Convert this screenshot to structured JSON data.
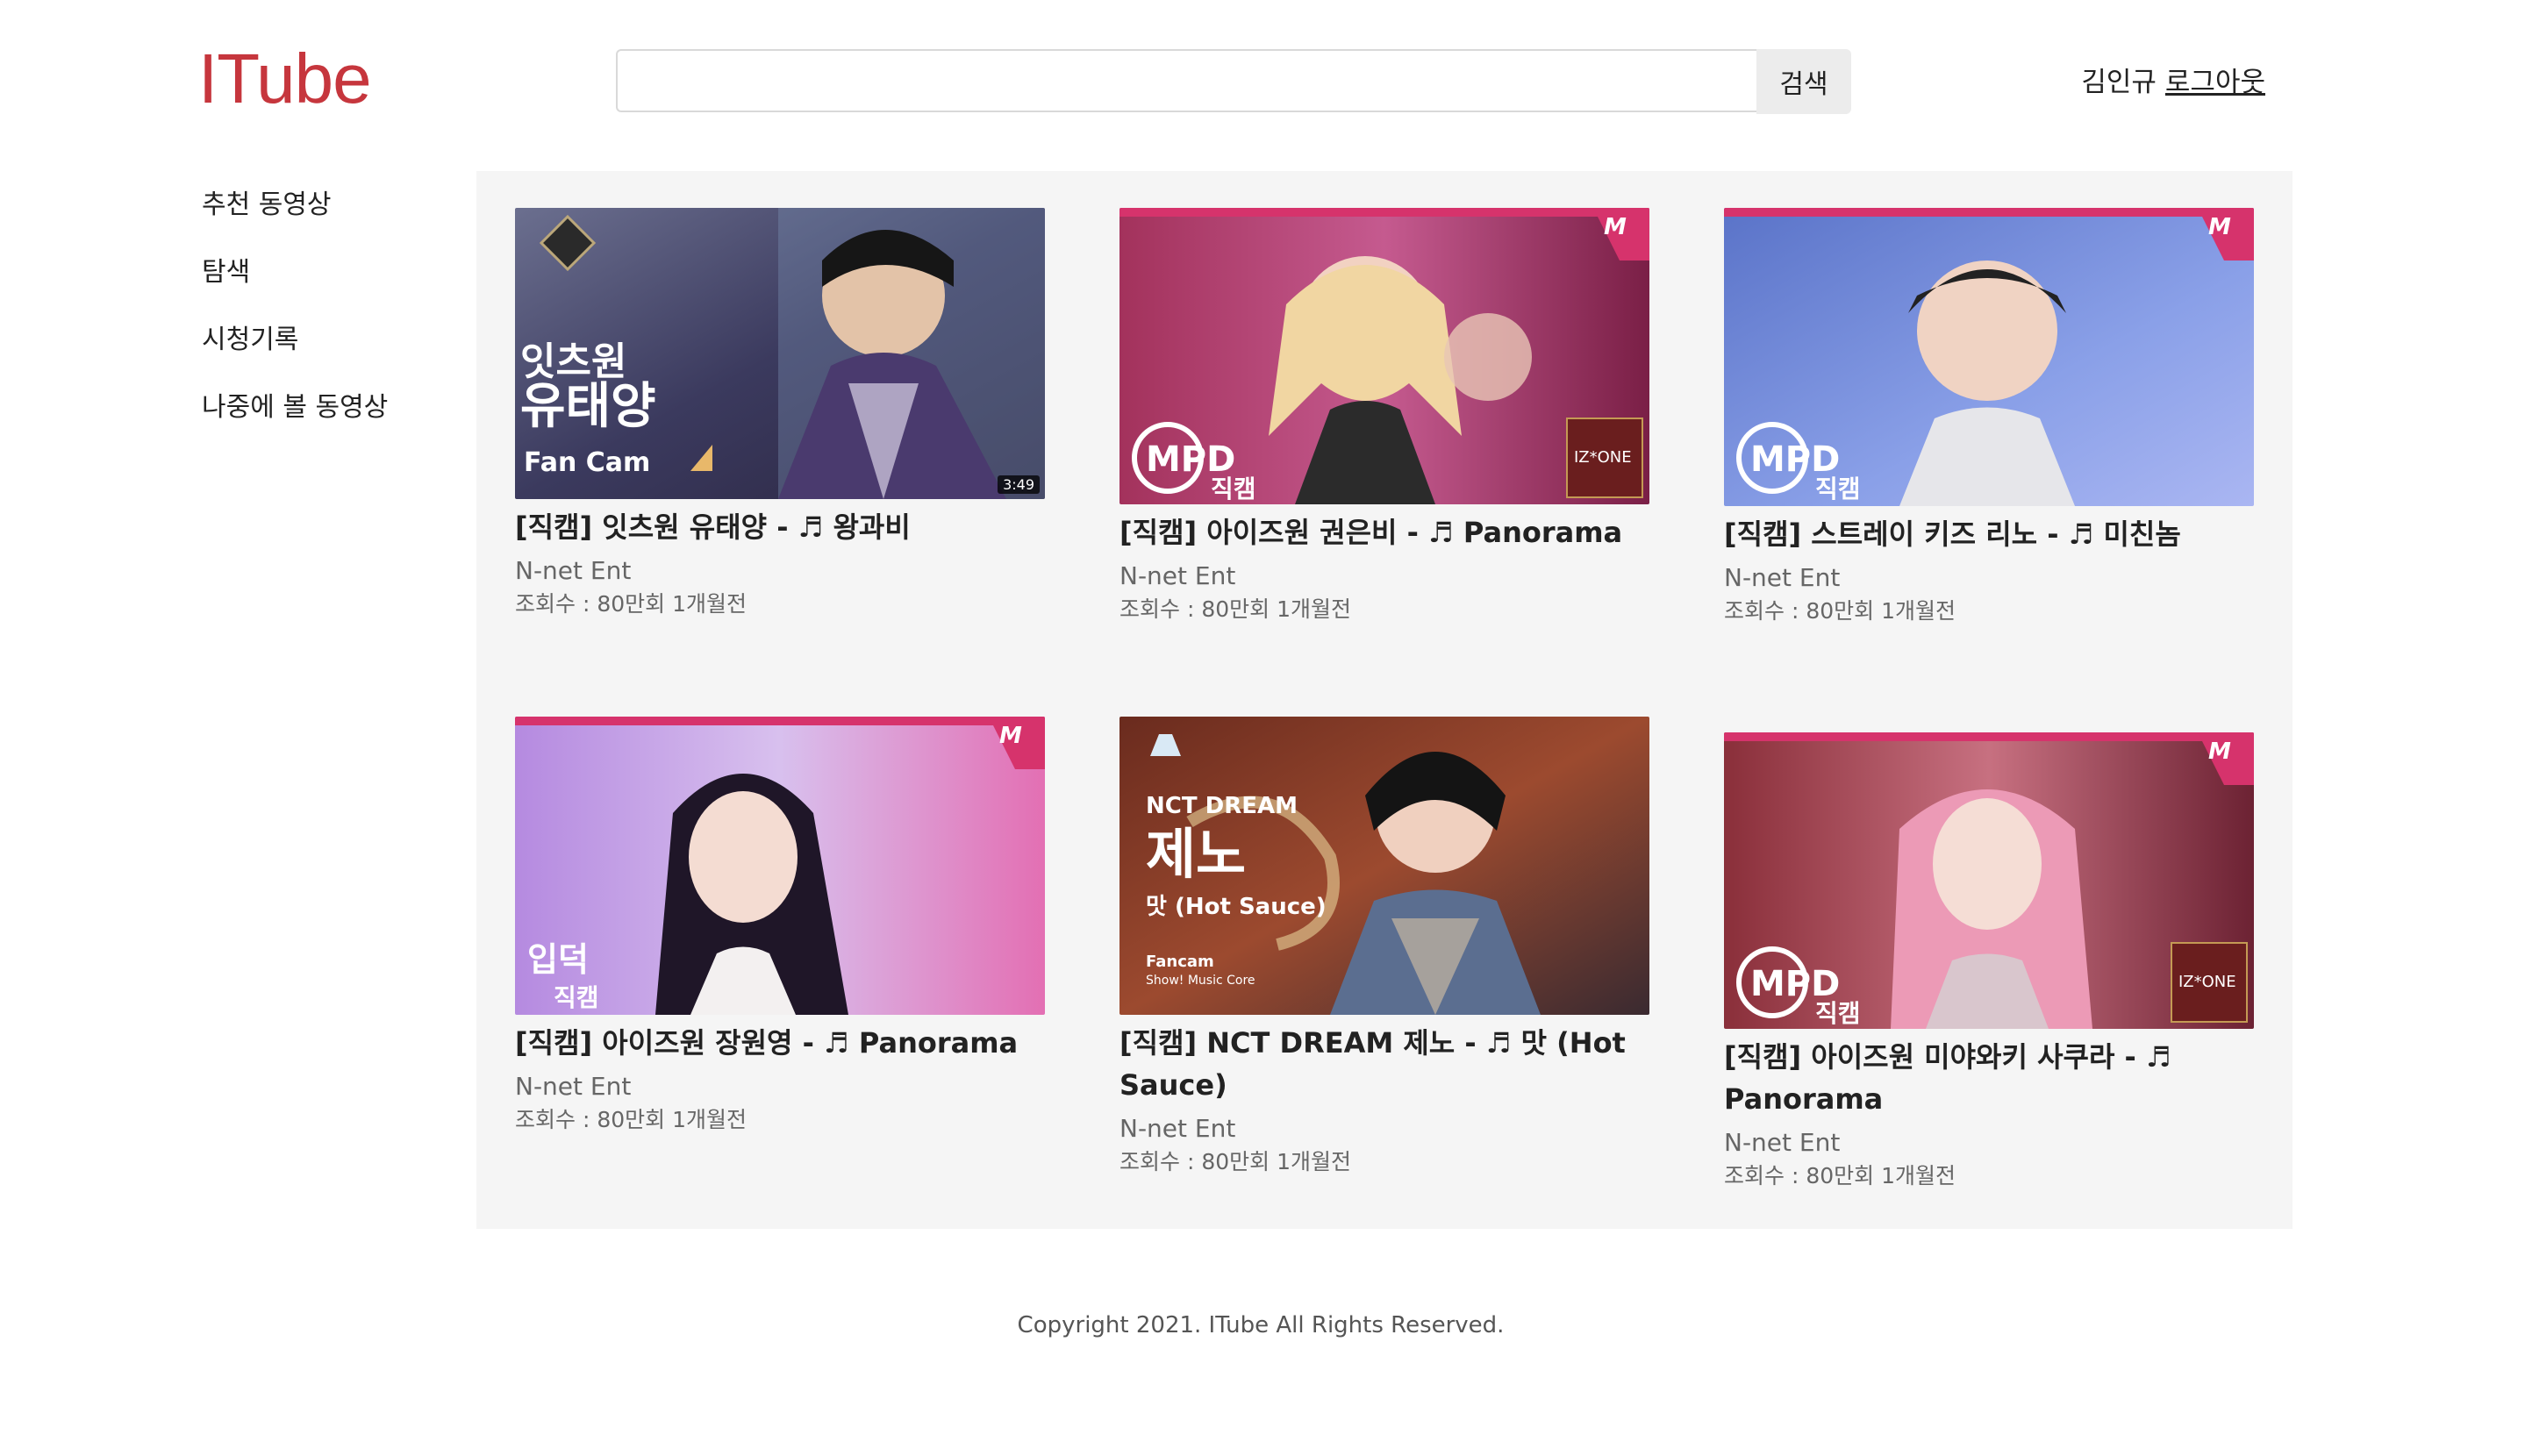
{
  "header": {
    "logo": "ITube",
    "search": {
      "placeholder": "",
      "value": "",
      "button_label": "검색"
    },
    "user": {
      "name": "김인규",
      "logout_label": "로그아웃"
    }
  },
  "sidebar": {
    "items": [
      {
        "label": "추천 동영상"
      },
      {
        "label": "탐색"
      },
      {
        "label": "시청기록"
      },
      {
        "label": "나중에 볼 동영상"
      }
    ]
  },
  "videos": [
    {
      "title": "[직캠] 잇츠원 유태양 - ♬ 왕과비",
      "channel": "N-net Ent",
      "meta": "조회수 : 80만회 1개월전",
      "thumb_text": [
        "잇츠원",
        "유태양",
        "Fan Cam"
      ],
      "duration": "3:49"
    },
    {
      "title": "[직캠] 아이즈원 권은비 - ♬ Panorama",
      "channel": "N-net Ent",
      "meta": "조회수 : 80만회 1개월전",
      "thumb_text": [
        "MPD",
        "직캠",
        "IZ*ONE"
      ]
    },
    {
      "title": "[직캠] 스트레이 키즈 리노 - ♬ 미친놈",
      "channel": "N-net Ent",
      "meta": "조회수 : 80만회 1개월전",
      "thumb_text": [
        "MPD",
        "직캠"
      ]
    },
    {
      "title": "[직캠] 아이즈원 장원영 - ♬ Panorama",
      "channel": "N-net Ent",
      "meta": "조회수 : 80만회 1개월전",
      "thumb_text": [
        "입덕",
        "직캠"
      ]
    },
    {
      "title": "[직캠] NCT DREAM 제노 - ♬ 맛 (Hot Sauce)",
      "channel": "N-net Ent",
      "meta": "조회수 : 80만회 1개월전",
      "thumb_text": [
        "NCT DREAM",
        "제노",
        "맛 (Hot Sauce)",
        "Fancam",
        "Show! Music Core"
      ]
    },
    {
      "title": "[직캠] 아이즈원 미야와키 사쿠라 - ♬ Panorama",
      "channel": "N-net Ent",
      "meta": "조회수 : 80만회 1개월전",
      "thumb_text": [
        "MPD",
        "직캠",
        "IZ*ONE"
      ]
    }
  ],
  "footer": {
    "copyright": "Copyright 2021. ITube All Rights Reserved."
  },
  "colors": {
    "brand": "#c6363d",
    "panel_bg": "#f5f5f5",
    "mnet_pink": "#d6336c"
  }
}
